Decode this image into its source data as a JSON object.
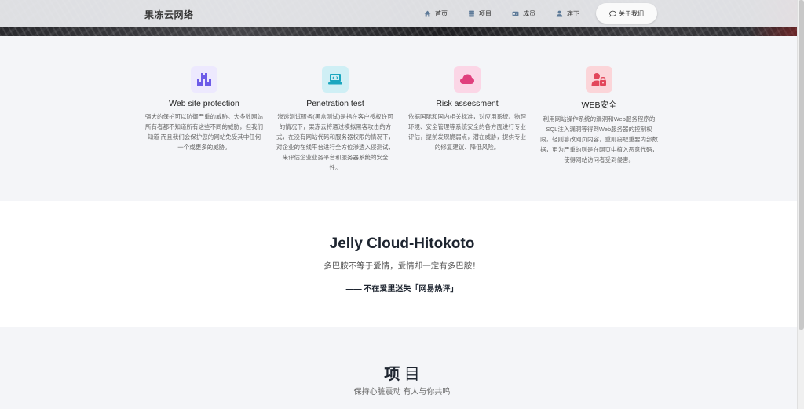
{
  "navbar": {
    "brand": "果冻云网络",
    "links": [
      {
        "label": "首页",
        "icon": "home-icon"
      },
      {
        "label": "项目",
        "icon": "server-icon"
      },
      {
        "label": "成员",
        "icon": "id-card-icon"
      },
      {
        "label": "旗下",
        "icon": "user-icon"
      }
    ],
    "about": "关于我们"
  },
  "services": [
    {
      "title": "Web site protection",
      "icon": "boxes-icon",
      "color": "#ede9fe",
      "icon_color": "#6d5ce8",
      "desc": "强大的保护可以防御严重的威胁。大多数网站所有者都不知道所有这些不同的威胁，但我们知道 而且我们会保护您的网站免受其中任何一个或更多的威胁。"
    },
    {
      "title": "Penetration test",
      "icon": "laptop-code-icon",
      "color": "#cfeff5",
      "icon_color": "#1aa6bf",
      "desc": "渗透测试服务(黑盒测试)是指在客户授权许可的情况下，果冻云将通过模拟黑客攻击的方式，在没有网站代码和服务器权限的情况下，对企业的在线平台进行全方位渗透入侵测试，来评估企业业务平台和服务器系统的安全 性。"
    },
    {
      "title": "Risk assessment",
      "icon": "cloud-icon",
      "color": "#fbd6e6",
      "icon_color": "#e0407d",
      "desc": "依据国际和国内相关标准，对应用系统、物理环境、安全管理等系统安全的各方面进行专业评估，提前发现脆弱点，潜在威胁，提供专业的修复建议、降低风险。"
    },
    {
      "title": "WEB安全",
      "icon": "user-lock-icon",
      "color": "#fbd5d9",
      "icon_color": "#e2465a",
      "desc": "利用网站操作系统的漏洞和Web服务程序的SQL注入漏洞等得到Web服务器的控制权限，轻则篡改网页内容，重则窃取重要内部数据，更为严重的则是在网页中植入恶意代码，使得网站访问者受到侵害。"
    }
  ],
  "quote": {
    "title": "Jelly Cloud-Hitokoto",
    "text": "多巴胺不等于爱情，爱情却一定有多巴胺！",
    "source": "—— 不在爱里迷失「网易热评」"
  },
  "projects": {
    "title_bold": "项",
    "title_rest": " 目",
    "subtitle": "保持心脏震动 有人与你共鸣"
  }
}
